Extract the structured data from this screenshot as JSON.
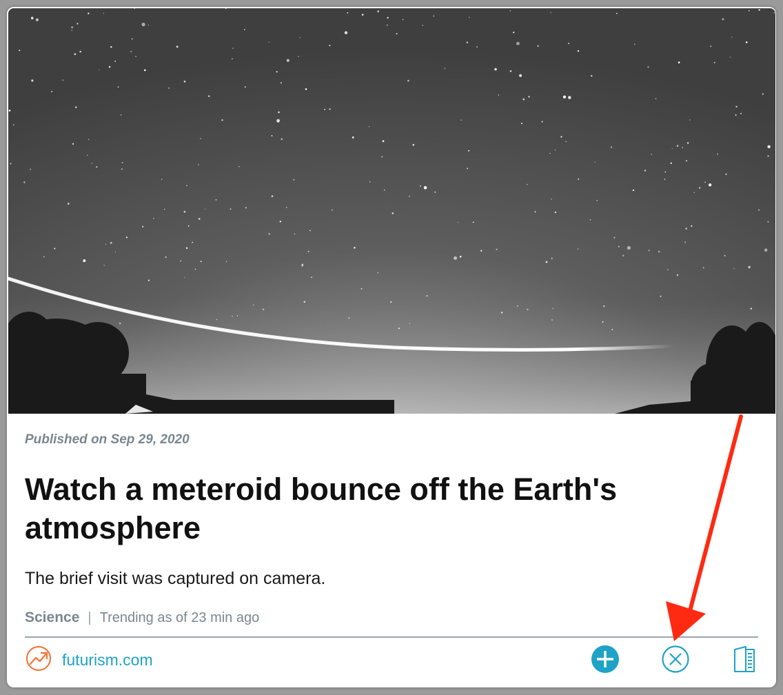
{
  "article": {
    "published": "Published on Sep 29, 2020",
    "title": "Watch a meteroid bounce off the Earth's atmosphere",
    "subtitle": "The brief visit was captured on camera.",
    "category": "Science",
    "separator": "|",
    "trending": "Trending as of 23 min ago",
    "source": "futurism.com"
  },
  "icons": {
    "trending": "trending-up-icon",
    "add": "plus-circle-icon",
    "dismiss": "close-circle-icon",
    "read": "reader-view-icon"
  },
  "colors": {
    "accent": "#1ea3c7",
    "trending_icon": "#f07a3e",
    "meta_text": "#7a8791",
    "annotation_arrow": "#ff2a12"
  }
}
